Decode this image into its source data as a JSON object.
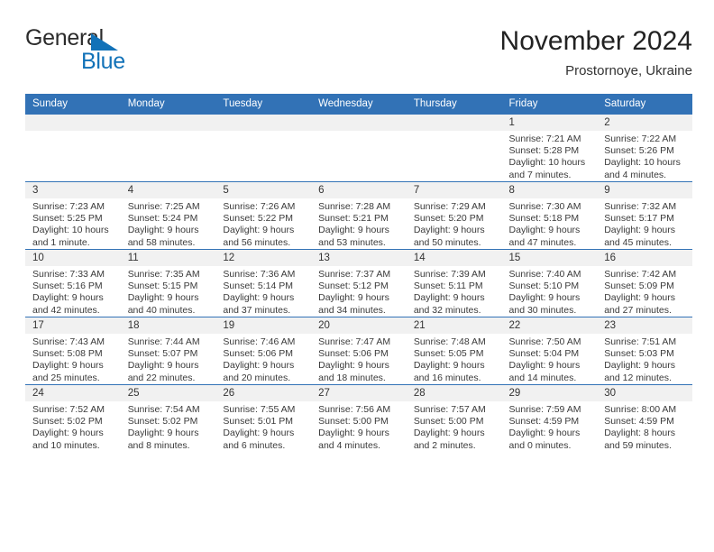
{
  "brand": {
    "name_top": "General",
    "name_bottom": "Blue",
    "triangle_icon": "triangle-icon",
    "accent_color": "#1272b8"
  },
  "header": {
    "month_title": "November 2024",
    "location": "Prostornoye, Ukraine"
  },
  "theme": {
    "header_blue": "#3272b6",
    "daynum_gray": "#f1f1f1",
    "text": "#3a3a3a"
  },
  "calendar": {
    "weekday_headers": [
      "Sunday",
      "Monday",
      "Tuesday",
      "Wednesday",
      "Thursday",
      "Friday",
      "Saturday"
    ],
    "weeks": [
      [
        {
          "day": "",
          "lines": []
        },
        {
          "day": "",
          "lines": []
        },
        {
          "day": "",
          "lines": []
        },
        {
          "day": "",
          "lines": []
        },
        {
          "day": "",
          "lines": []
        },
        {
          "day": "1",
          "lines": [
            "Sunrise: 7:21 AM",
            "Sunset: 5:28 PM",
            "Daylight: 10 hours",
            "and 7 minutes."
          ]
        },
        {
          "day": "2",
          "lines": [
            "Sunrise: 7:22 AM",
            "Sunset: 5:26 PM",
            "Daylight: 10 hours",
            "and 4 minutes."
          ]
        }
      ],
      [
        {
          "day": "3",
          "lines": [
            "Sunrise: 7:23 AM",
            "Sunset: 5:25 PM",
            "Daylight: 10 hours",
            "and 1 minute."
          ]
        },
        {
          "day": "4",
          "lines": [
            "Sunrise: 7:25 AM",
            "Sunset: 5:24 PM",
            "Daylight: 9 hours",
            "and 58 minutes."
          ]
        },
        {
          "day": "5",
          "lines": [
            "Sunrise: 7:26 AM",
            "Sunset: 5:22 PM",
            "Daylight: 9 hours",
            "and 56 minutes."
          ]
        },
        {
          "day": "6",
          "lines": [
            "Sunrise: 7:28 AM",
            "Sunset: 5:21 PM",
            "Daylight: 9 hours",
            "and 53 minutes."
          ]
        },
        {
          "day": "7",
          "lines": [
            "Sunrise: 7:29 AM",
            "Sunset: 5:20 PM",
            "Daylight: 9 hours",
            "and 50 minutes."
          ]
        },
        {
          "day": "8",
          "lines": [
            "Sunrise: 7:30 AM",
            "Sunset: 5:18 PM",
            "Daylight: 9 hours",
            "and 47 minutes."
          ]
        },
        {
          "day": "9",
          "lines": [
            "Sunrise: 7:32 AM",
            "Sunset: 5:17 PM",
            "Daylight: 9 hours",
            "and 45 minutes."
          ]
        }
      ],
      [
        {
          "day": "10",
          "lines": [
            "Sunrise: 7:33 AM",
            "Sunset: 5:16 PM",
            "Daylight: 9 hours",
            "and 42 minutes."
          ]
        },
        {
          "day": "11",
          "lines": [
            "Sunrise: 7:35 AM",
            "Sunset: 5:15 PM",
            "Daylight: 9 hours",
            "and 40 minutes."
          ]
        },
        {
          "day": "12",
          "lines": [
            "Sunrise: 7:36 AM",
            "Sunset: 5:14 PM",
            "Daylight: 9 hours",
            "and 37 minutes."
          ]
        },
        {
          "day": "13",
          "lines": [
            "Sunrise: 7:37 AM",
            "Sunset: 5:12 PM",
            "Daylight: 9 hours",
            "and 34 minutes."
          ]
        },
        {
          "day": "14",
          "lines": [
            "Sunrise: 7:39 AM",
            "Sunset: 5:11 PM",
            "Daylight: 9 hours",
            "and 32 minutes."
          ]
        },
        {
          "day": "15",
          "lines": [
            "Sunrise: 7:40 AM",
            "Sunset: 5:10 PM",
            "Daylight: 9 hours",
            "and 30 minutes."
          ]
        },
        {
          "day": "16",
          "lines": [
            "Sunrise: 7:42 AM",
            "Sunset: 5:09 PM",
            "Daylight: 9 hours",
            "and 27 minutes."
          ]
        }
      ],
      [
        {
          "day": "17",
          "lines": [
            "Sunrise: 7:43 AM",
            "Sunset: 5:08 PM",
            "Daylight: 9 hours",
            "and 25 minutes."
          ]
        },
        {
          "day": "18",
          "lines": [
            "Sunrise: 7:44 AM",
            "Sunset: 5:07 PM",
            "Daylight: 9 hours",
            "and 22 minutes."
          ]
        },
        {
          "day": "19",
          "lines": [
            "Sunrise: 7:46 AM",
            "Sunset: 5:06 PM",
            "Daylight: 9 hours",
            "and 20 minutes."
          ]
        },
        {
          "day": "20",
          "lines": [
            "Sunrise: 7:47 AM",
            "Sunset: 5:06 PM",
            "Daylight: 9 hours",
            "and 18 minutes."
          ]
        },
        {
          "day": "21",
          "lines": [
            "Sunrise: 7:48 AM",
            "Sunset: 5:05 PM",
            "Daylight: 9 hours",
            "and 16 minutes."
          ]
        },
        {
          "day": "22",
          "lines": [
            "Sunrise: 7:50 AM",
            "Sunset: 5:04 PM",
            "Daylight: 9 hours",
            "and 14 minutes."
          ]
        },
        {
          "day": "23",
          "lines": [
            "Sunrise: 7:51 AM",
            "Sunset: 5:03 PM",
            "Daylight: 9 hours",
            "and 12 minutes."
          ]
        }
      ],
      [
        {
          "day": "24",
          "lines": [
            "Sunrise: 7:52 AM",
            "Sunset: 5:02 PM",
            "Daylight: 9 hours",
            "and 10 minutes."
          ]
        },
        {
          "day": "25",
          "lines": [
            "Sunrise: 7:54 AM",
            "Sunset: 5:02 PM",
            "Daylight: 9 hours",
            "and 8 minutes."
          ]
        },
        {
          "day": "26",
          "lines": [
            "Sunrise: 7:55 AM",
            "Sunset: 5:01 PM",
            "Daylight: 9 hours",
            "and 6 minutes."
          ]
        },
        {
          "day": "27",
          "lines": [
            "Sunrise: 7:56 AM",
            "Sunset: 5:00 PM",
            "Daylight: 9 hours",
            "and 4 minutes."
          ]
        },
        {
          "day": "28",
          "lines": [
            "Sunrise: 7:57 AM",
            "Sunset: 5:00 PM",
            "Daylight: 9 hours",
            "and 2 minutes."
          ]
        },
        {
          "day": "29",
          "lines": [
            "Sunrise: 7:59 AM",
            "Sunset: 4:59 PM",
            "Daylight: 9 hours",
            "and 0 minutes."
          ]
        },
        {
          "day": "30",
          "lines": [
            "Sunrise: 8:00 AM",
            "Sunset: 4:59 PM",
            "Daylight: 8 hours",
            "and 59 minutes."
          ]
        }
      ]
    ]
  }
}
